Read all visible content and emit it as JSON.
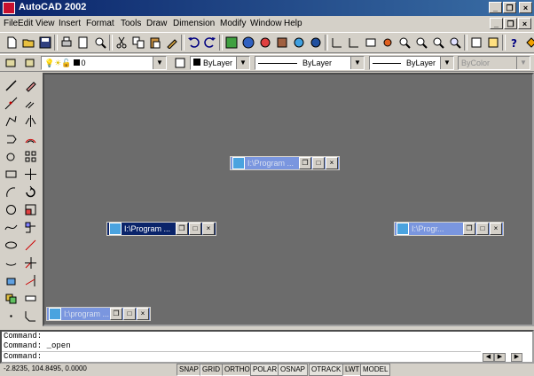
{
  "app": {
    "title": "AutoCAD 2002"
  },
  "menu": [
    "File",
    "Edit",
    "View",
    "Insert",
    "Format",
    "Tools",
    "Draw",
    "Dimension",
    "Modify",
    "Window",
    "Help"
  ],
  "properties_toolbar": {
    "layer": "0",
    "color": "ByLayer",
    "linetype": "ByLayer",
    "lineweight": "ByLayer",
    "plotstyle": "ByColor"
  },
  "drawing_windows": [
    {
      "title": "I:\\Program ..."
    },
    {
      "title": "I:\\Program ..."
    },
    {
      "title": "I:\\Progr..."
    },
    {
      "title": "I:\\program ..."
    }
  ],
  "command": {
    "lines": [
      "Command:",
      "Command: _open",
      "Command:"
    ]
  },
  "status": {
    "coords": "-2.8235, 104.8495, 0.0000",
    "toggles": [
      {
        "label": "SNAP",
        "on": false
      },
      {
        "label": "GRID",
        "on": false
      },
      {
        "label": "ORTHO",
        "on": false
      },
      {
        "label": "POLAR",
        "on": true
      },
      {
        "label": "OSNAP",
        "on": true
      },
      {
        "label": "OTRACK",
        "on": true
      },
      {
        "label": "LWT",
        "on": false
      },
      {
        "label": "MODEL",
        "on": true
      }
    ]
  },
  "colors": {
    "titlebar": "#0a246a",
    "drawing_bg": "#6c6c6c",
    "active_caption": "#0a246a",
    "inactive_caption": "#7a96df"
  }
}
